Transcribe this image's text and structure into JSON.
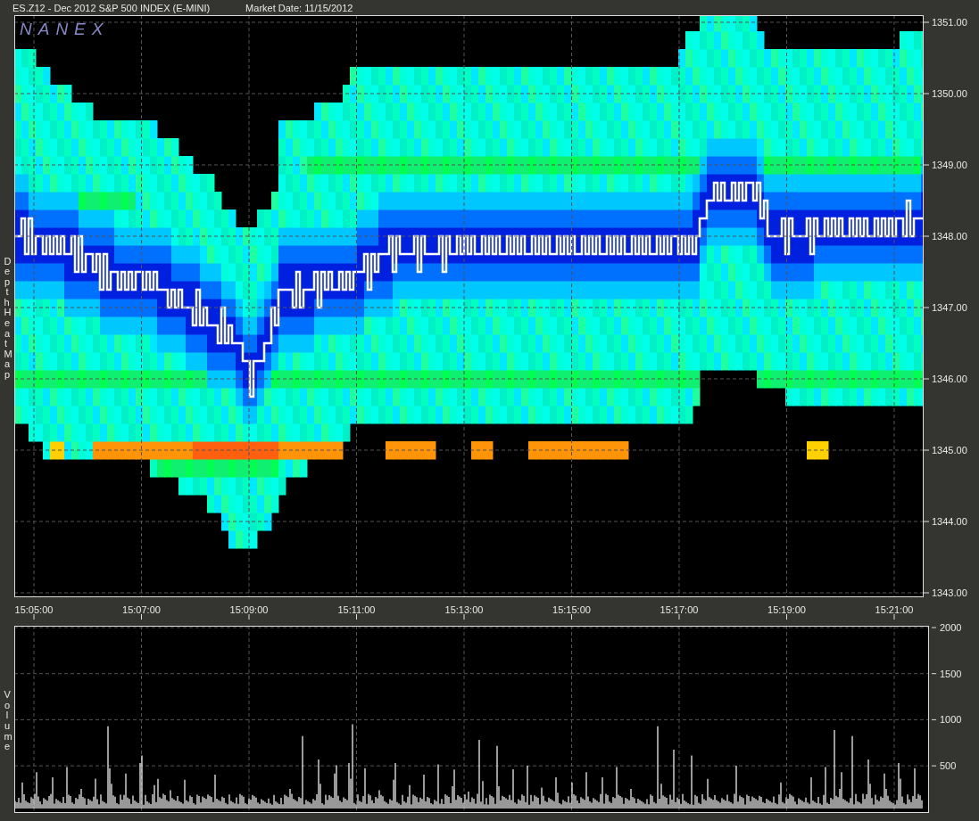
{
  "window": {
    "title": "ES.Z12 - Dec 2012 S&P 500 INDEX (E-MINI)",
    "market_date": "Market Date: 11/15/2012"
  },
  "heatmap_panel": {
    "logo": "NANEX",
    "side_label": "Depth Heat Map",
    "price_ticks": [
      "1351.00",
      "1350.00",
      "1349.00",
      "1348.00",
      "1347.00",
      "1346.00",
      "1345.00",
      "1344.00",
      "1343.00"
    ],
    "time_ticks": [
      "15:05:00",
      "15:07:00",
      "15:09:00",
      "15:11:00",
      "15:13:00",
      "15:15:00",
      "15:17:00",
      "15:19:00",
      "15:21:00"
    ]
  },
  "volume_panel": {
    "side_label": "Volume",
    "volume_ticks": [
      "2000",
      "1500",
      "1000",
      "500"
    ]
  }
}
